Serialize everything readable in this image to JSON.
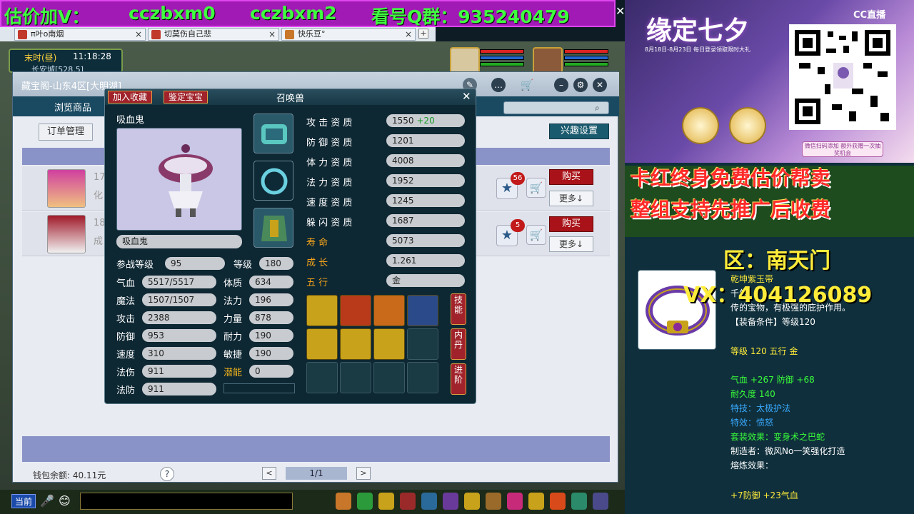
{
  "banner": {
    "part1": "估价加V：",
    "part2": "cczbxm0",
    "part3": "cczbxm2",
    "part4": "看号Q群：935240479",
    "close": "✕"
  },
  "browser_tabs": [
    {
      "label": "π叶o南烟"
    },
    {
      "label": "切莫伤自己悲"
    },
    {
      "label": "快乐豆°"
    }
  ],
  "game": {
    "clock": {
      "period": "末时(昼)",
      "time": "11:18:28",
      "location": "长安城[528,5]"
    },
    "store": {
      "title": "藏宝阁-山东4区[大明湖]",
      "browse_tab": "浏览商品",
      "order_button": "订单管理",
      "interest_button": "兴趣设置",
      "rows": [
        {
          "level": "17",
          "text": "化",
          "fav_count": "56",
          "buy": "购买",
          "more": "更多↓"
        },
        {
          "level": "18",
          "text": "成",
          "fav_count": "5",
          "buy": "购买",
          "more": "更多↓"
        }
      ],
      "wallet": "钱包余额: 40.11元",
      "help": "?",
      "page": "1/1",
      "prev": "<",
      "next": ">"
    },
    "pet": {
      "tab_collect": "加入收藏",
      "tab_appraise": "鉴定宝宝",
      "window_title": "召唤兽",
      "name": "吸血鬼",
      "name_box": "吸血鬼",
      "close": "✕",
      "battle_level_label": "参战等级",
      "battle_level": "95",
      "level_label": "等级",
      "level": "180",
      "stats_left": [
        {
          "label": "气血",
          "value": "5517/5517"
        },
        {
          "label": "魔法",
          "value": "1507/1507"
        },
        {
          "label": "攻击",
          "value": "2388"
        },
        {
          "label": "防御",
          "value": "953"
        },
        {
          "label": "速度",
          "value": "310"
        },
        {
          "label": "法伤",
          "value": "911"
        },
        {
          "label": "法防",
          "value": "911"
        }
      ],
      "stats_mid": [
        {
          "label": "体质",
          "value": "634"
        },
        {
          "label": "法力",
          "value": "196"
        },
        {
          "label": "力量",
          "value": "878"
        },
        {
          "label": "耐力",
          "value": "190"
        },
        {
          "label": "敏捷",
          "value": "190"
        },
        {
          "label": "潜能",
          "value": "0"
        }
      ],
      "aptitudes": [
        {
          "label": "攻 击 资 质",
          "value": "1550",
          "bonus": "+20"
        },
        {
          "label": "防 御 资 质",
          "value": "1201",
          "bonus": ""
        },
        {
          "label": "体 力 资 质",
          "value": "4008",
          "bonus": ""
        },
        {
          "label": "法 力 资 质",
          "value": "1952",
          "bonus": ""
        },
        {
          "label": "速 度 资 质",
          "value": "1245",
          "bonus": ""
        },
        {
          "label": "躲 闪 资 质",
          "value": "1687",
          "bonus": ""
        }
      ],
      "lifespan_label": "寿         命",
      "lifespan": "5073",
      "growth_label": "成         长",
      "growth": "1.261",
      "element_label": "五         行",
      "element": "金",
      "side_buttons": [
        "技能",
        "内丹",
        "进阶"
      ]
    },
    "bottom": {
      "now_button": "当前"
    }
  },
  "right_panel": {
    "ad_title": "缘定七夕",
    "ad_sub": "8月18日-8月23日 每日登录领取限时大礼",
    "cc_logo": "CC直播",
    "qr_note": "微信扫码添加 额外获赠一次抽奖机会",
    "promo_line1": "卡红终身免费估价帮卖",
    "promo_line2": "整组支持先推广后收费",
    "region": "区：南天门",
    "vx": "VX：404126089",
    "item": {
      "name": "乾坤紫玉带",
      "desc1": "千年",
      "desc2": "传的宝物，有极强的庇护作用。",
      "equip_req": "【装备条件】等级120",
      "level_line": "等级 120  五行 金",
      "attrs": "气血 +267 防御 +68",
      "durability": "耐久度 140",
      "skill": "特技：太极护法",
      "effect": "特效：愤怒",
      "set": "套装效果：变身术之巴蛇",
      "maker": "制造者：微风No一笑强化打造",
      "refine": "熔炼效果：",
      "refine_val": "+7防御 +23气血"
    }
  }
}
